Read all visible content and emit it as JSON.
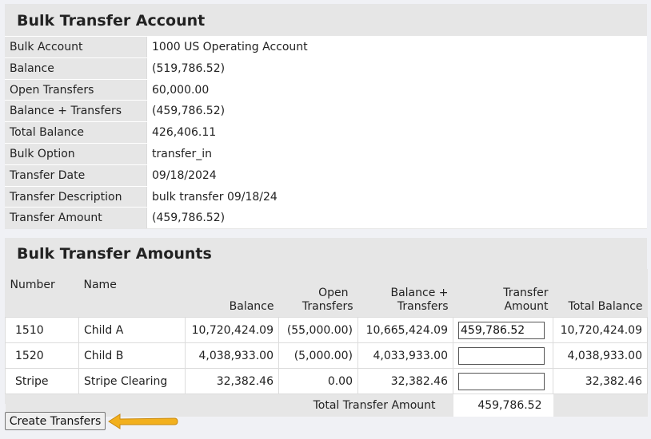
{
  "account": {
    "title": "Bulk Transfer Account",
    "rows": [
      {
        "label": "Bulk Account",
        "value": "1000 US Operating Account"
      },
      {
        "label": "Balance",
        "value": "(519,786.52)"
      },
      {
        "label": "Open Transfers",
        "value": "60,000.00"
      },
      {
        "label": "Balance + Transfers",
        "value": "(459,786.52)"
      },
      {
        "label": "Total Balance",
        "value": "426,406.11"
      },
      {
        "label": "Bulk Option",
        "value": "transfer_in"
      },
      {
        "label": "Transfer Date",
        "value": "09/18/2024"
      },
      {
        "label": "Transfer Description",
        "value": "bulk transfer 09/18/24"
      },
      {
        "label": "Transfer Amount",
        "value": "(459,786.52)"
      }
    ]
  },
  "amounts": {
    "title": "Bulk Transfer Amounts",
    "headers": {
      "number": "Number",
      "name": "Name",
      "balance": "Balance",
      "open_transfers_1": "Open",
      "open_transfers_2": "Transfers",
      "bal_transfers_1": "Balance +",
      "bal_transfers_2": "Transfers",
      "transfer_amount_1": "Transfer",
      "transfer_amount_2": "Amount",
      "total_balance": "Total Balance"
    },
    "rows": [
      {
        "number": "1510",
        "name": "Child A",
        "balance": "10,720,424.09",
        "open": "(55,000.00)",
        "bal_transfers": "10,665,424.09",
        "transfer_amount": "459,786.52",
        "total_balance": "10,720,424.09"
      },
      {
        "number": "1520",
        "name": "Child B",
        "balance": "4,038,933.00",
        "open": "(5,000.00)",
        "bal_transfers": "4,033,933.00",
        "transfer_amount": "",
        "total_balance": "4,038,933.00"
      },
      {
        "number": "Stripe",
        "name": "Stripe Clearing",
        "balance": "32,382.46",
        "open": "0.00",
        "bal_transfers": "32,382.46",
        "transfer_amount": "",
        "total_balance": "32,382.46"
      }
    ],
    "total_label": "Total Transfer Amount",
    "total_value": "459,786.52"
  },
  "button": {
    "label": "Create Transfers"
  },
  "colors": {
    "arrow": "#f2b01e",
    "panel": "#e6e6e6",
    "background": "#f0f1f5"
  }
}
